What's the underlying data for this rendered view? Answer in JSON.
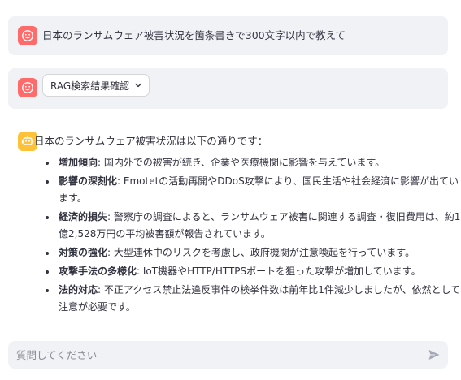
{
  "messages": {
    "user_question": "日本のランサムウェア被害状況を箇条書きで300文字以内で教えて",
    "rag_expander_label": "RAG検索結果確認",
    "assistant_intro": "日本のランサムウェア被害状況は以下の通りです：",
    "bullets": [
      {
        "title": "増加傾向",
        "text": ": 国内外での被害が続き、企業や医療機関に影響を与えています。"
      },
      {
        "title": "影響の深刻化",
        "text": ": Emotetの活動再開やDDoS攻撃により、国民生活や社会経済に影響が出ています。"
      },
      {
        "title": "経済的損失",
        "text": ": 警察庁の調査によると、ランサムウェア被害に関連する調査・復旧費用は、約1億2,528万円の平均被害額が報告されています。"
      },
      {
        "title": "対策の強化",
        "text": ": 大型連休中のリスクを考慮し、政府機関が注意喚起を行っています。"
      },
      {
        "title": "攻撃手法の多様化",
        "text": ": IoT機器やHTTP/HTTPSポートを狙った攻撃が増加しています。"
      },
      {
        "title": "法的対応",
        "text": ": 不正アクセス禁止法違反事件の検挙件数は前年比1件減少しましたが、依然として注意が必要です。"
      }
    ]
  },
  "chat_input": {
    "placeholder": "質問してください"
  },
  "colors": {
    "user_avatar": "#ff6b6b",
    "assistant_avatar": "#fdc13a",
    "message_bg": "#f0f2f6"
  },
  "icons": {
    "user_avatar": "smiley-face-icon",
    "assistant_avatar": "robot-icon",
    "expander": "chevron-down-icon",
    "send": "send-arrow-icon"
  }
}
